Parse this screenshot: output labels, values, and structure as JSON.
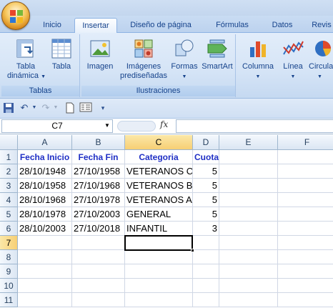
{
  "ribbon": {
    "tabs": [
      {
        "label": "Inicio",
        "active": false
      },
      {
        "label": "Insertar",
        "active": true
      },
      {
        "label": "Diseño de página",
        "active": false
      },
      {
        "label": "Fórmulas",
        "active": false
      },
      {
        "label": "Datos",
        "active": false
      },
      {
        "label": "Revis",
        "active": false
      }
    ],
    "groups": {
      "tablas": {
        "label": "Tablas",
        "tabla_dinamica_line1": "Tabla",
        "tabla_dinamica_line2": "dinámica",
        "tabla": "Tabla"
      },
      "ilustraciones": {
        "label": "Ilustraciones",
        "imagen": "Imagen",
        "imagenes_line1": "Imágenes",
        "imagenes_line2": "prediseñadas",
        "formas": "Formas",
        "smartart": "SmartArt"
      },
      "graficos": {
        "columna": "Columna",
        "linea": "Línea",
        "circular": "Circula"
      }
    },
    "accent": "#15428b"
  },
  "formula_bar": {
    "name_box": "C7",
    "fx_label": "fx",
    "formula": ""
  },
  "sheet": {
    "columns": [
      "A",
      "B",
      "C",
      "D",
      "E",
      "F"
    ],
    "rows": [
      "1",
      "2",
      "3",
      "4",
      "5",
      "6",
      "7",
      "8",
      "9",
      "10",
      "11"
    ],
    "selected_column": "C",
    "selected_row": "7",
    "active_cell": "C7",
    "header_color": "#1f2fc5",
    "data": [
      [
        "Fecha Inicio",
        "Fecha Fin",
        "Categoria",
        "Cuota",
        "",
        ""
      ],
      [
        "28/10/1948",
        "27/10/1958",
        "VETERANOS C",
        "5",
        "",
        ""
      ],
      [
        "28/10/1958",
        "27/10/1968",
        "VETERANOS B",
        "5",
        "",
        ""
      ],
      [
        "28/10/1968",
        "27/10/1978",
        "VETERANOS A",
        "5",
        "",
        ""
      ],
      [
        "28/10/1978",
        "27/10/2003",
        "GENERAL",
        "5",
        "",
        ""
      ],
      [
        "28/10/2003",
        "27/10/2018",
        "INFANTIL",
        "3",
        "",
        ""
      ],
      [
        "",
        "",
        "",
        "",
        "",
        ""
      ],
      [
        "",
        "",
        "",
        "",
        "",
        ""
      ],
      [
        "",
        "",
        "",
        "",
        "",
        ""
      ],
      [
        "",
        "",
        "",
        "",
        "",
        ""
      ],
      [
        "",
        "",
        "",
        "",
        "",
        ""
      ]
    ]
  }
}
